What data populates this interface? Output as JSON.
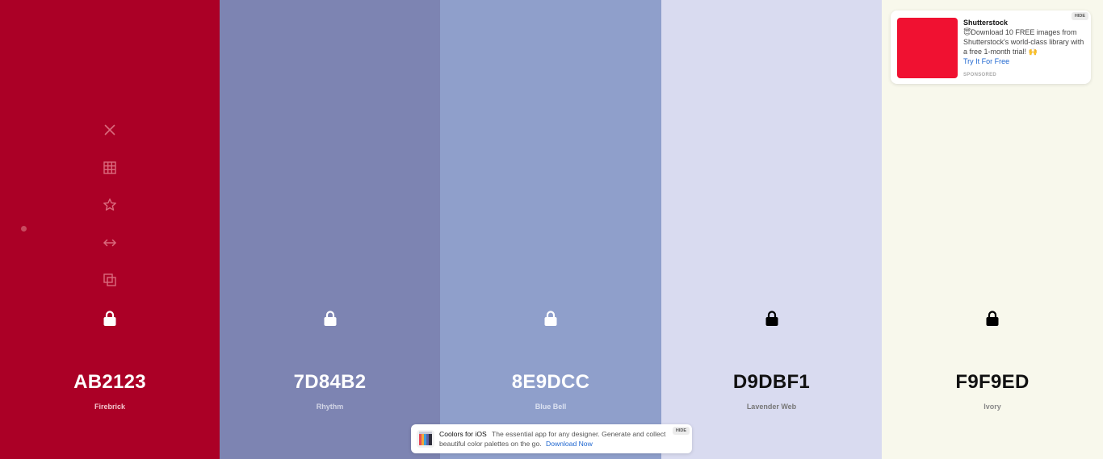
{
  "swatches": [
    {
      "hex": "AB2123",
      "name": "Firebrick",
      "bg": "#AB0026",
      "text_color": "#FFFFFF",
      "name_color": "#F3C7CF",
      "lock_color": "#FFFFFF"
    },
    {
      "hex": "7D84B2",
      "name": "Rhythm",
      "bg": "#7D84B2",
      "text_color": "#FFFFFF",
      "name_color": "#D3D6E6",
      "lock_color": "#FFFFFF"
    },
    {
      "hex": "8E9DCC",
      "name": "Blue Bell",
      "bg": "#8F9FCB",
      "text_color": "#FFFFFF",
      "name_color": "#DCE2F1",
      "lock_color": "#FFFFFF"
    },
    {
      "hex": "D9DBF1",
      "name": "Lavender Web",
      "bg": "#D9DBF0",
      "text_color": "#111111",
      "name_color": "#777777",
      "lock_color": "#000000"
    },
    {
      "hex": "F9F9ED",
      "name": "Ivory",
      "bg": "#F8F8EC",
      "text_color": "#111111",
      "name_color": "#888888",
      "lock_color": "#000000"
    }
  ],
  "tools": [
    {
      "name": "remove-color",
      "icon": "close-icon"
    },
    {
      "name": "view-shades",
      "icon": "grid-icon"
    },
    {
      "name": "save-color",
      "icon": "star-icon"
    },
    {
      "name": "drag-color",
      "icon": "arrows-horizontal-icon"
    },
    {
      "name": "copy-hex",
      "icon": "copy-icon"
    }
  ],
  "tool_color": "#DA6B7E",
  "ad": {
    "title": "Shutterstock",
    "body": "😇Download 10 FREE images from Shutterstock's world-class library with a free 1-month trial! 🙌",
    "cta": "Try It For Free",
    "sponsored": "SPONSORED",
    "hide": "HIDE",
    "thumb_color": "#F01131"
  },
  "ios_banner": {
    "title": "Coolors for iOS",
    "text": "The essential app for any designer. Generate and collect beautiful color palettes on the go.",
    "cta": "Download Now",
    "hide": "HIDE"
  }
}
